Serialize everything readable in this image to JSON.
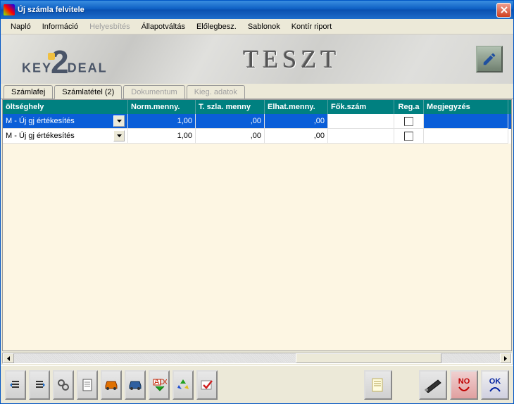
{
  "window": {
    "title": "Új számla felvitele"
  },
  "menu": {
    "items": [
      {
        "label": "Napló",
        "disabled": false
      },
      {
        "label": "Információ",
        "disabled": false
      },
      {
        "label": "Helyesbítés",
        "disabled": true
      },
      {
        "label": "Állapotváltás",
        "disabled": false
      },
      {
        "label": "Előlegbesz.",
        "disabled": false
      },
      {
        "label": "Sablonok",
        "disabled": false
      },
      {
        "label": "Kontír riport",
        "disabled": false
      }
    ]
  },
  "banner": {
    "brand_left": "KEY",
    "brand_num": "2",
    "brand_right": "DEAL",
    "center": "TESZT"
  },
  "tabs": [
    {
      "label": "Számlafej",
      "active": false,
      "disabled": false
    },
    {
      "label": "Számlatétel (2)",
      "active": true,
      "disabled": false
    },
    {
      "label": "Dokumentum",
      "active": false,
      "disabled": true
    },
    {
      "label": "Kieg. adatok",
      "active": false,
      "disabled": true
    }
  ],
  "grid": {
    "headers": [
      "öltséghely",
      "Norm.menny.",
      "T. szla. menny",
      "Elhat.menny.",
      "Fők.szám",
      "Reg.a",
      "Megjegyzés"
    ],
    "rows": [
      {
        "selected": true,
        "koltseghely": "M - Új gj értékesítés",
        "norm": "1,00",
        "tszla": ",00",
        "elhat": ",00",
        "fokszam": "",
        "rega": false,
        "megj": ""
      },
      {
        "selected": false,
        "koltseghely": "M - Új gj értékesítés",
        "norm": "1,00",
        "tszla": ",00",
        "elhat": ",00",
        "fokszam": "",
        "rega": false,
        "megj": ""
      }
    ]
  },
  "buttons": {
    "no": "NO",
    "ok": "OK"
  }
}
